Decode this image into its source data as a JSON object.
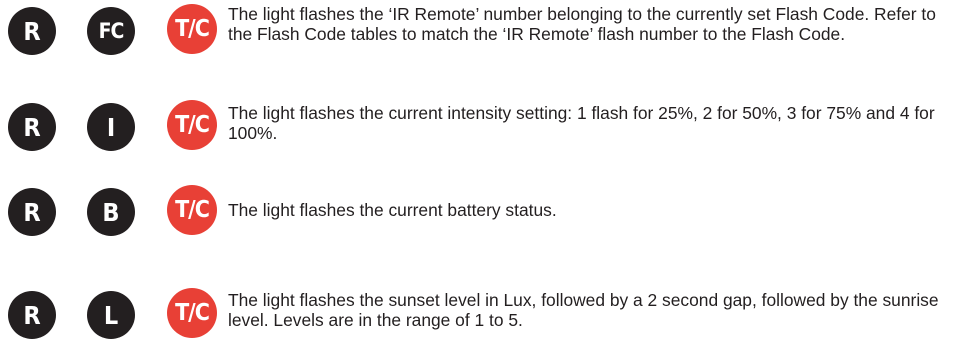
{
  "colors": {
    "dark_button": "#231f20",
    "tc_button": "#e84036",
    "text": "#231f20"
  },
  "rows": [
    {
      "remote_label": "R",
      "function_label": "FC",
      "tc_label": "T/C",
      "description": "The light flashes the ‘IR Remote’ number belonging to the currently set Flash Code. Refer to the Flash Code tables to match the ‘IR Remote’ flash number to the Flash Code."
    },
    {
      "remote_label": "R",
      "function_label": "I",
      "tc_label": "T/C",
      "description": "The light flashes the current intensity setting: 1 flash for 25%, 2 for 50%, 3 for 75% and 4 for 100%."
    },
    {
      "remote_label": "R",
      "function_label": "B",
      "tc_label": "T/C",
      "description": "The light flashes the current battery status."
    },
    {
      "remote_label": "R",
      "function_label": "L",
      "tc_label": "T/C",
      "description": "The light flashes the sunset level in Lux, followed by a 2 second gap, followed by the sunrise level. Levels are in the range of 1 to 5."
    }
  ]
}
